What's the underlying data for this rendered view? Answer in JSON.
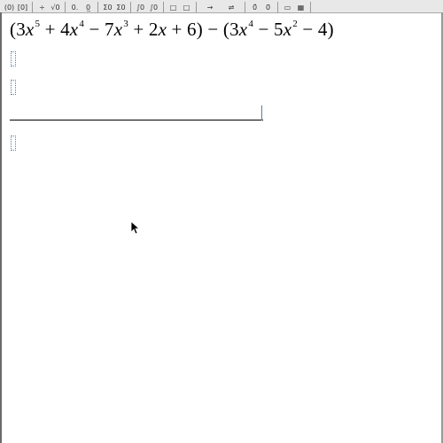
{
  "toolbar": {
    "groups": [
      [
        "(0)",
        "[0]"
      ],
      [
        "÷",
        "√0"
      ],
      [
        "0.",
        "0̲"
      ],
      [
        "Σ0",
        "Σ0"
      ],
      [
        "∫0",
        "∫0"
      ],
      [
        "□",
        "□"
      ],
      [
        "→",
        "⇌"
      ],
      [
        "0̂",
        "0̃"
      ],
      [
        "▭",
        "▦"
      ]
    ]
  },
  "document": {
    "expression": {
      "open1": "(3",
      "x1": "x",
      "e1": "5",
      "t2a": " + 4",
      "x2": "x",
      "e2": "4",
      "t3a": " − 7",
      "x3": "x",
      "e3": "3",
      "t4a": " + 2",
      "x4": "x",
      "t5": " + 6) − (3",
      "x5": "x",
      "e5": "4",
      "t6a": " − 5",
      "x6": "x",
      "e6": "2",
      "t7": " − 4)"
    }
  },
  "colors": {
    "placeholder_border": "#5a7fa8",
    "toolbar_bg": "#e8e8e8",
    "text": "#000000"
  }
}
